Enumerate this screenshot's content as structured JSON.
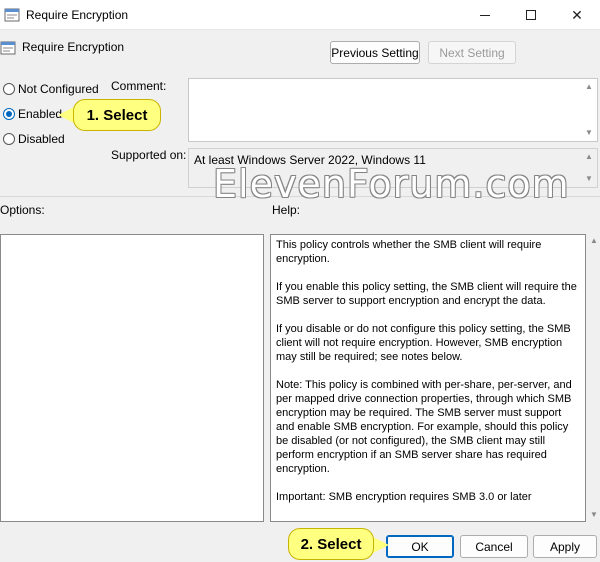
{
  "window": {
    "title": "Require Encryption",
    "icon": "policy-setting-icon",
    "controls": {
      "minimize": "minimize-icon",
      "maximize": "maximize-icon",
      "close": "✕"
    }
  },
  "header": {
    "policy_name": "Require Encryption",
    "previous_setting": "Previous Setting",
    "next_setting": "Next Setting"
  },
  "state": {
    "options": [
      "Not Configured",
      "Enabled",
      "Disabled"
    ],
    "selected": "Enabled"
  },
  "comment": {
    "label": "Comment:",
    "value": ""
  },
  "supported": {
    "label": "Supported on:",
    "value": "At least Windows Server 2022, Windows 11"
  },
  "options_panel": {
    "label": "Options:"
  },
  "help_panel": {
    "label": "Help:",
    "paragraphs": [
      "This policy controls whether the SMB client will require encryption.",
      "If you enable this policy setting, the SMB client will require the SMB server to support encryption and encrypt the data.",
      "If you disable or do not configure this policy setting, the SMB client will not require encryption. However, SMB encryption may still be required; see notes below.",
      "Note: This policy is combined with per-share, per-server, and per mapped drive connection properties, through which SMB encryption may be required. The SMB server must support and enable SMB encryption. For example, should this policy be disabled (or not configured), the SMB client may still perform encryption if an SMB server share has required encryption.",
      "Important: SMB encryption requires SMB 3.0 or later"
    ]
  },
  "footer": {
    "ok": "OK",
    "cancel": "Cancel",
    "apply": "Apply"
  },
  "annotations": {
    "step1": "1. Select",
    "step2": "2. Select",
    "callout_color": "#ffff80"
  },
  "watermark": "ElevenForum.com",
  "accent_color": "#0067c0"
}
